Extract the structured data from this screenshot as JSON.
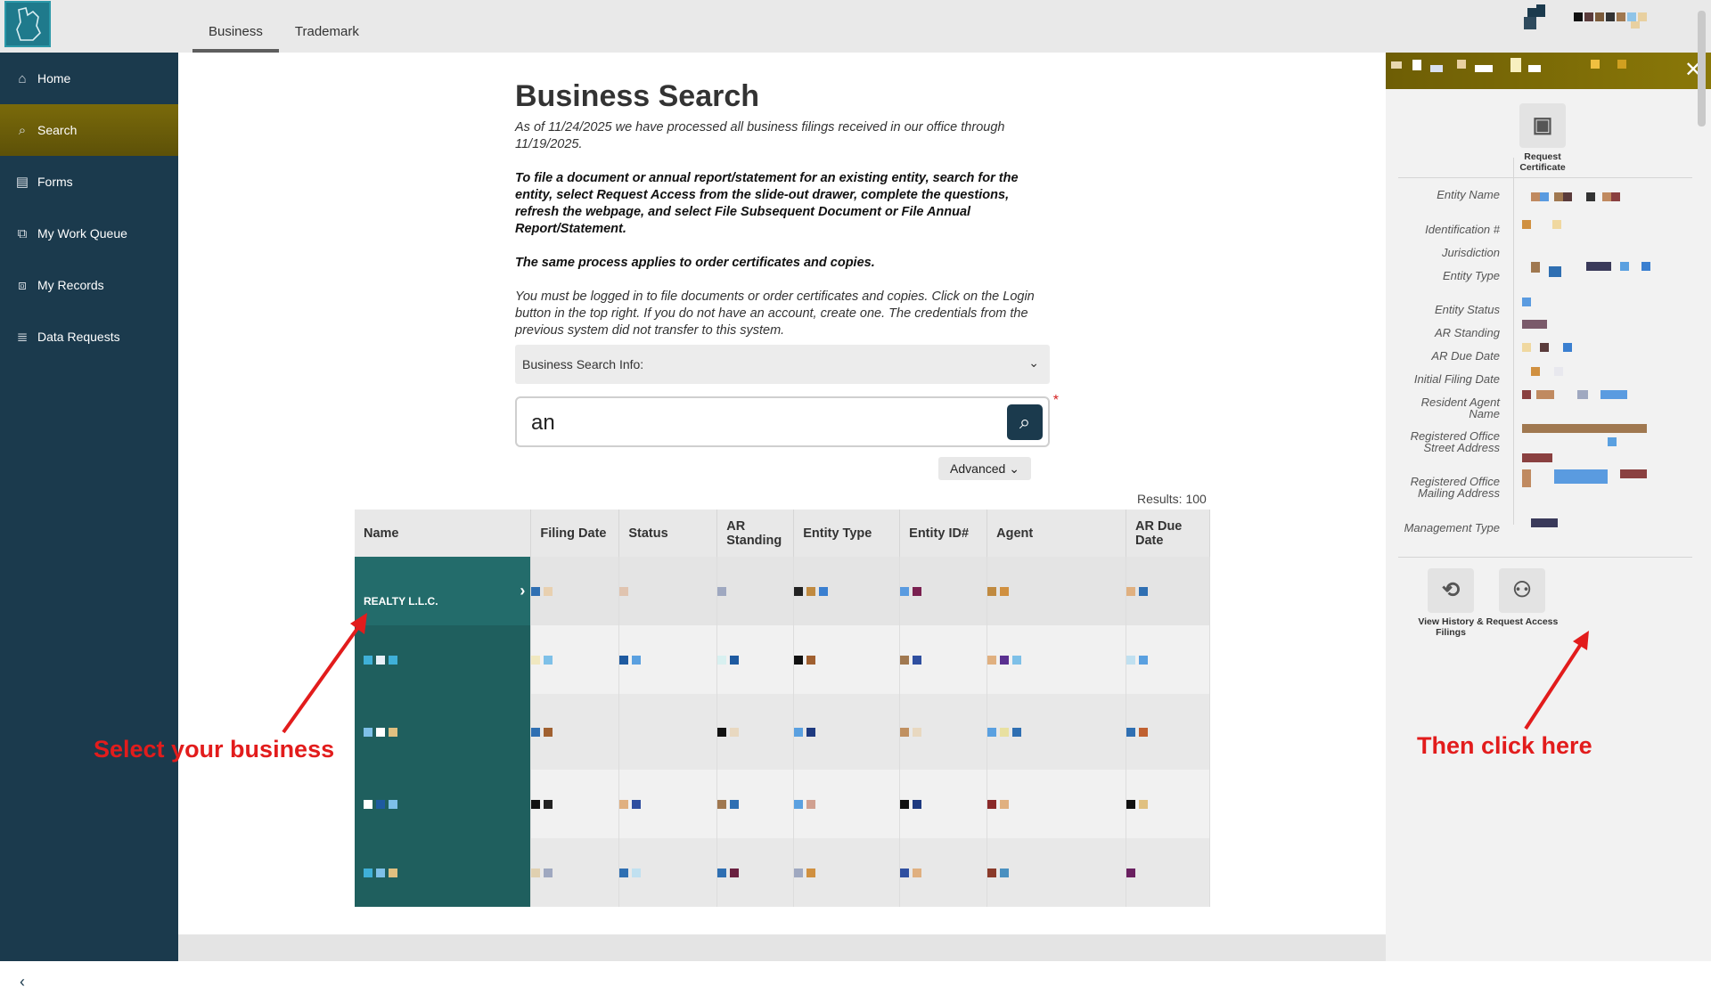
{
  "header": {
    "tabs": [
      {
        "label": "Business",
        "active": true
      },
      {
        "label": "Trademark",
        "active": false
      }
    ]
  },
  "sidebar": {
    "items": [
      {
        "label": "Home",
        "icon": "home-icon"
      },
      {
        "label": "Search",
        "icon": "search-icon",
        "active": true
      },
      {
        "label": "Forms",
        "icon": "forms-icon"
      },
      {
        "label": "My Work Queue",
        "icon": "work-queue-icon"
      },
      {
        "label": "My Records",
        "icon": "records-icon"
      },
      {
        "label": "Data Requests",
        "icon": "database-icon"
      }
    ]
  },
  "main": {
    "title": "Business Search",
    "processed_text": "As of 11/24/2025 we have processed all business filings received in our office through 11/19/2025.",
    "instructions": "To file a document or annual report/statement for an existing entity, search for the entity, select Request Access from the slide-out drawer, complete the questions, refresh the webpage, and select File Subsequent Document or File Annual Report/Statement.",
    "same_process": "The same process applies to order certificates and copies.",
    "login_note": "You must be logged in to file documents or order certificates and copies. Click on the Login button in the top right. If you do not have an account, create one. The credentials from the previous system did not transfer to this system.",
    "accordion_label": "Business Search Info:",
    "search_value": "an",
    "advanced_label": "Advanced",
    "results_label": "Results: 100",
    "table": {
      "columns": [
        "Name",
        "Filing Date",
        "Status",
        "AR Standing",
        "Entity Type",
        "Entity ID#",
        "Agent",
        "AR Due Date"
      ],
      "first_row_name": "REALTY L.L.C."
    }
  },
  "drawer": {
    "request_certificate": "Request Certificate",
    "fields": [
      "Entity Name",
      "Identification #",
      "Jurisdiction",
      "Entity Type",
      "Entity Status",
      "AR Standing",
      "AR Due Date",
      "Initial Filing Date",
      "Resident Agent Name",
      "Registered Office Street Address",
      "Registered Office Mailing Address",
      "Management Type"
    ],
    "view_history": "View History & Filings",
    "request_access": "Request Access"
  },
  "annotations": {
    "select_business": "Select your business",
    "click_here": "Then click here"
  },
  "colors": {
    "sidebar": "#1b3a4d",
    "accent_gold": "#6e5e05",
    "teal_row": "#1f5f5e",
    "annotation_red": "#e21c1c"
  }
}
